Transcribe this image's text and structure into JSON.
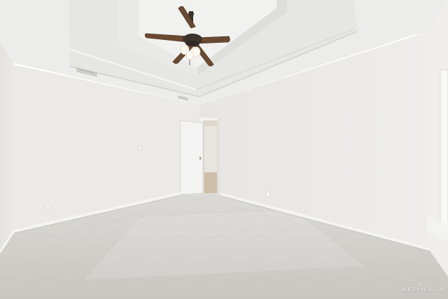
{
  "watermark": {
    "text": "GREATER MCALLEN"
  },
  "colors": {
    "wall_left": "#ecebe8",
    "wall_back": "#ebeae7",
    "wall_right": "#e9e8e5",
    "ceiling": "#eeeeec",
    "floor": "#cfccc8",
    "baseboard": "#f4f4f2",
    "fan_wood": "#6b4a32",
    "fan_metal": "#3b332d",
    "door": "#f3f3f1"
  },
  "icons": {
    "ceiling_fan": "ceiling-fan-icon",
    "air_vent": "air-vent-icon",
    "outlet": "outlet-icon",
    "house_logo": "house-icon"
  }
}
